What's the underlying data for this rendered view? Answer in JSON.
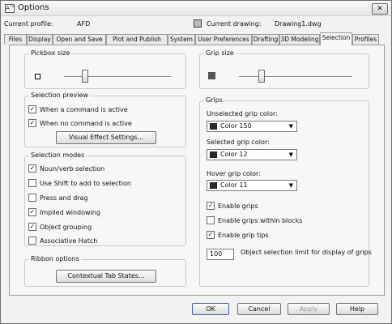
{
  "window": {
    "title": "Options",
    "icon_text": "A™"
  },
  "profile": {
    "current_profile_label": "Current profile:",
    "current_profile_value": "AFD",
    "current_drawing_label": "Current drawing:",
    "current_drawing_value": "Drawing1.dwg"
  },
  "tabs": [
    "Files",
    "Display",
    "Open and Save",
    "Plot and Publish",
    "System",
    "User Preferences",
    "Drafting",
    "3D Modeling",
    "Selection",
    "Profiles"
  ],
  "active_tab": "Selection",
  "pickbox": {
    "title": "Pickbox size",
    "level": 0.2
  },
  "selection_preview": {
    "title": "Selection preview",
    "items": [
      {
        "label": "When a command is active",
        "checked": true
      },
      {
        "label": "When no command is active",
        "checked": true
      }
    ],
    "visual_effect_button": "Visual Effect Settings..."
  },
  "selection_modes": {
    "title": "Selection modes",
    "items": [
      {
        "label": "Noun/verb selection",
        "checked": true
      },
      {
        "label": "Use Shift to add to selection",
        "checked": false
      },
      {
        "label": "Press and drag",
        "checked": false
      },
      {
        "label": "Implied windowing",
        "checked": true
      },
      {
        "label": "Object grouping",
        "checked": true
      },
      {
        "label": "Associative Hatch",
        "checked": false
      }
    ]
  },
  "ribbon_options": {
    "title": "Ribbon options",
    "button": "Contextual Tab States..."
  },
  "grip_size": {
    "title": "Grip size",
    "level": 0.2
  },
  "grips": {
    "title": "Grips",
    "unselected": {
      "label": "Unselected grip color:",
      "value": "Color 150",
      "color": "#2b2b2b"
    },
    "selected": {
      "label": "Selected grip color:",
      "value": "Color 12",
      "color": "#2b2b2b"
    },
    "hover": {
      "label": "Hover grip color:",
      "value": "Color 11",
      "color": "#2b2b2b"
    },
    "checks": [
      {
        "label": "Enable grips",
        "checked": true
      },
      {
        "label": "Enable grips within blocks",
        "checked": false
      },
      {
        "label": "Enable grip tips",
        "checked": true
      }
    ],
    "limit_value": "100",
    "limit_label": "Object selection limit for display of grips"
  },
  "footer": {
    "ok": "OK",
    "cancel": "Cancel",
    "apply": "Apply",
    "help": "Help"
  }
}
